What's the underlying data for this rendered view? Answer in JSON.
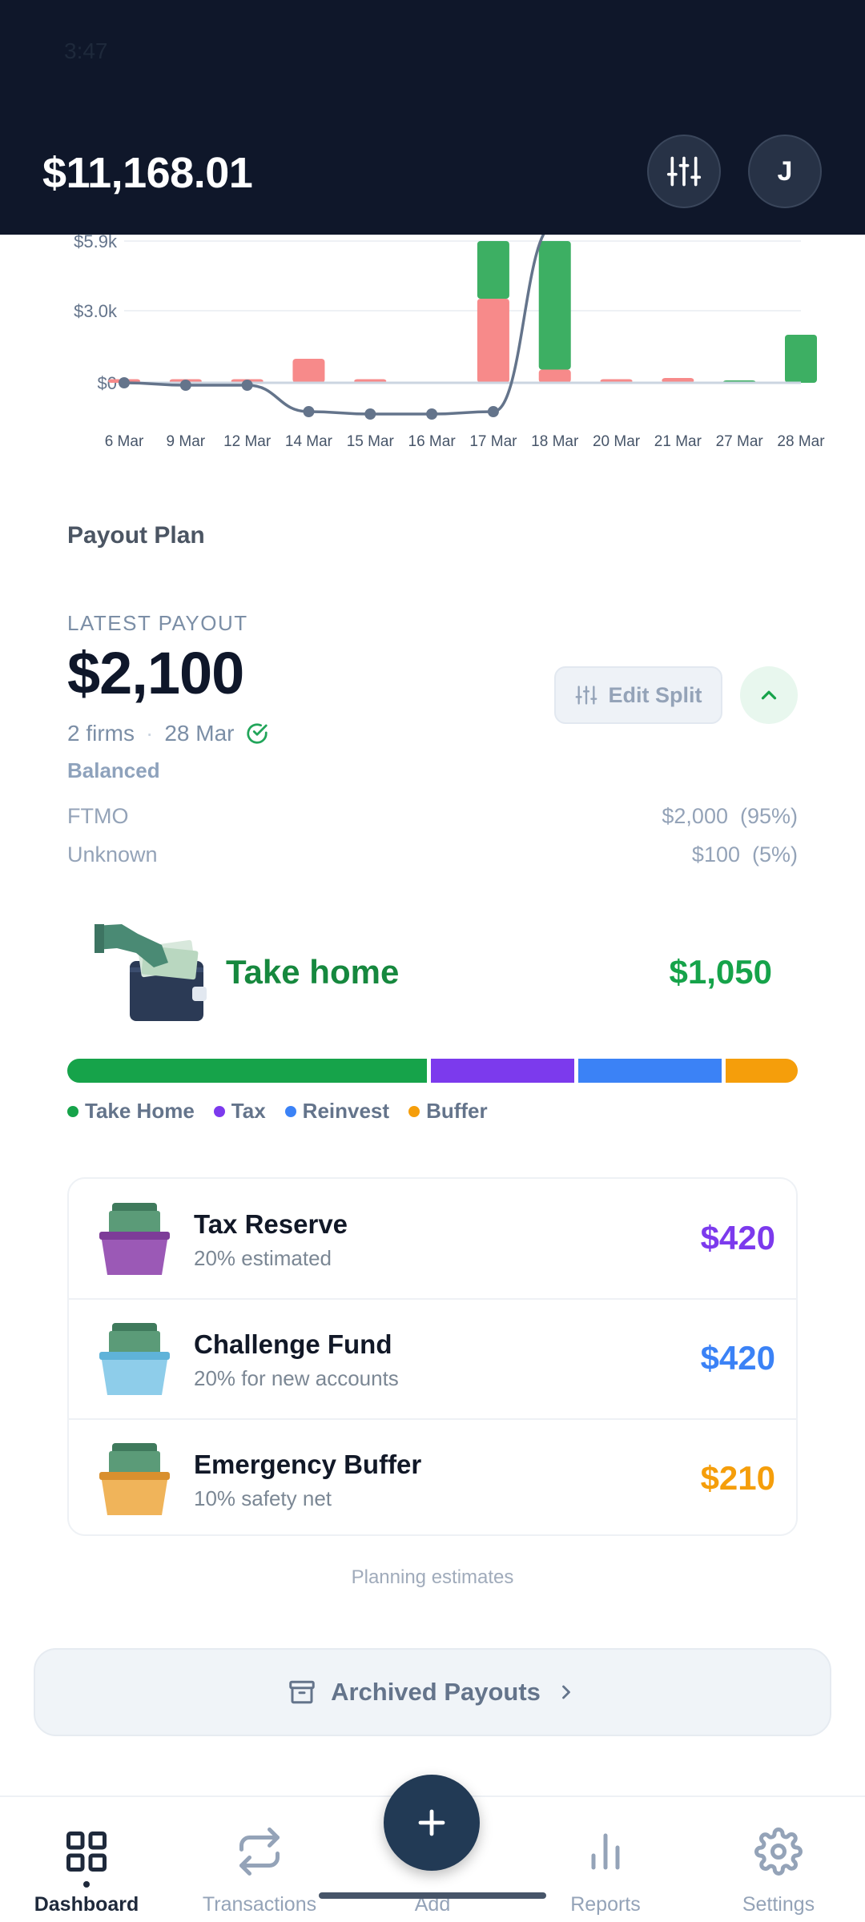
{
  "header": {
    "status_time": "3:47",
    "balance": "$11,168.01",
    "avatar_initial": "J"
  },
  "chart_data": {
    "type": "bar",
    "title": "",
    "y_tick_labels": [
      "$5.9k",
      "$3.0k",
      "$0"
    ],
    "categories": [
      "6 Mar",
      "9 Mar",
      "12 Mar",
      "14 Mar",
      "15 Mar",
      "16 Mar",
      "17 Mar",
      "18 Mar",
      "20 Mar",
      "21 Mar",
      "27 Mar",
      "28 Mar"
    ],
    "series": [
      {
        "values": [
          0,
          0,
          0,
          0,
          0,
          0,
          5900,
          5900,
          0,
          150,
          100,
          2000
        ],
        "color": "#3daf63"
      },
      {
        "values": [
          150,
          150,
          150,
          1000,
          150,
          0,
          3500,
          550,
          150,
          200,
          0,
          0
        ],
        "color": "#f78a8a"
      },
      {
        "values": [
          0,
          -100,
          -100,
          -1200,
          -1300,
          -1300,
          -1200,
          6600,
          6600,
          6600,
          6600,
          6600
        ],
        "color": "#64748b",
        "line": true
      }
    ],
    "ylim": [
      -1900,
      6700
    ]
  },
  "payout_plan": {
    "title": "Payout Plan",
    "latest_label": "LATEST PAYOUT",
    "amount": "$2,100",
    "firms": "2 firms",
    "date": "28 Mar",
    "status": "Balanced",
    "edit_split_label": "Edit Split",
    "rows": [
      {
        "name": "FTMO",
        "value": "$2,000  (95%)"
      },
      {
        "name": "Unknown",
        "value": "$100  (5%)"
      }
    ]
  },
  "take_home": {
    "label": "Take home",
    "amount": "$1,050"
  },
  "split": {
    "segments": [
      {
        "name": "Take Home",
        "share": 50,
        "color": "#16a34a"
      },
      {
        "name": "Tax",
        "share": 20,
        "color": "#7c3aed"
      },
      {
        "name": "Reinvest",
        "share": 20,
        "color": "#3b82f6"
      },
      {
        "name": "Buffer",
        "share": 10,
        "color": "#f59e0b"
      }
    ]
  },
  "allocations": [
    {
      "title": "Tax Reserve",
      "subtitle": "20% estimated",
      "amount": "$420",
      "color": "#7c3aed",
      "icon": "tax-reserve-money-pot-icon"
    },
    {
      "title": "Challenge Fund",
      "subtitle": "20% for new accounts",
      "amount": "$420",
      "color": "#3b82f6",
      "icon": "challenge-fund-money-pot-icon"
    },
    {
      "title": "Emergency Buffer",
      "subtitle": "10% safety net",
      "amount": "$210",
      "color": "#f59e0b",
      "icon": "emergency-buffer-money-pot-icon"
    }
  ],
  "estimates_note": "Planning estimates",
  "archived_label": "Archived Payouts",
  "nav": {
    "items": [
      {
        "label": "Dashboard",
        "icon": "grid-icon",
        "active": true
      },
      {
        "label": "Transactions",
        "icon": "swap-icon",
        "active": false
      },
      {
        "label": "Add",
        "icon": "plus-icon",
        "active": false
      },
      {
        "label": "Reports",
        "icon": "bar-chart-icon",
        "active": false
      },
      {
        "label": "Settings",
        "icon": "gear-icon",
        "active": false
      }
    ]
  }
}
